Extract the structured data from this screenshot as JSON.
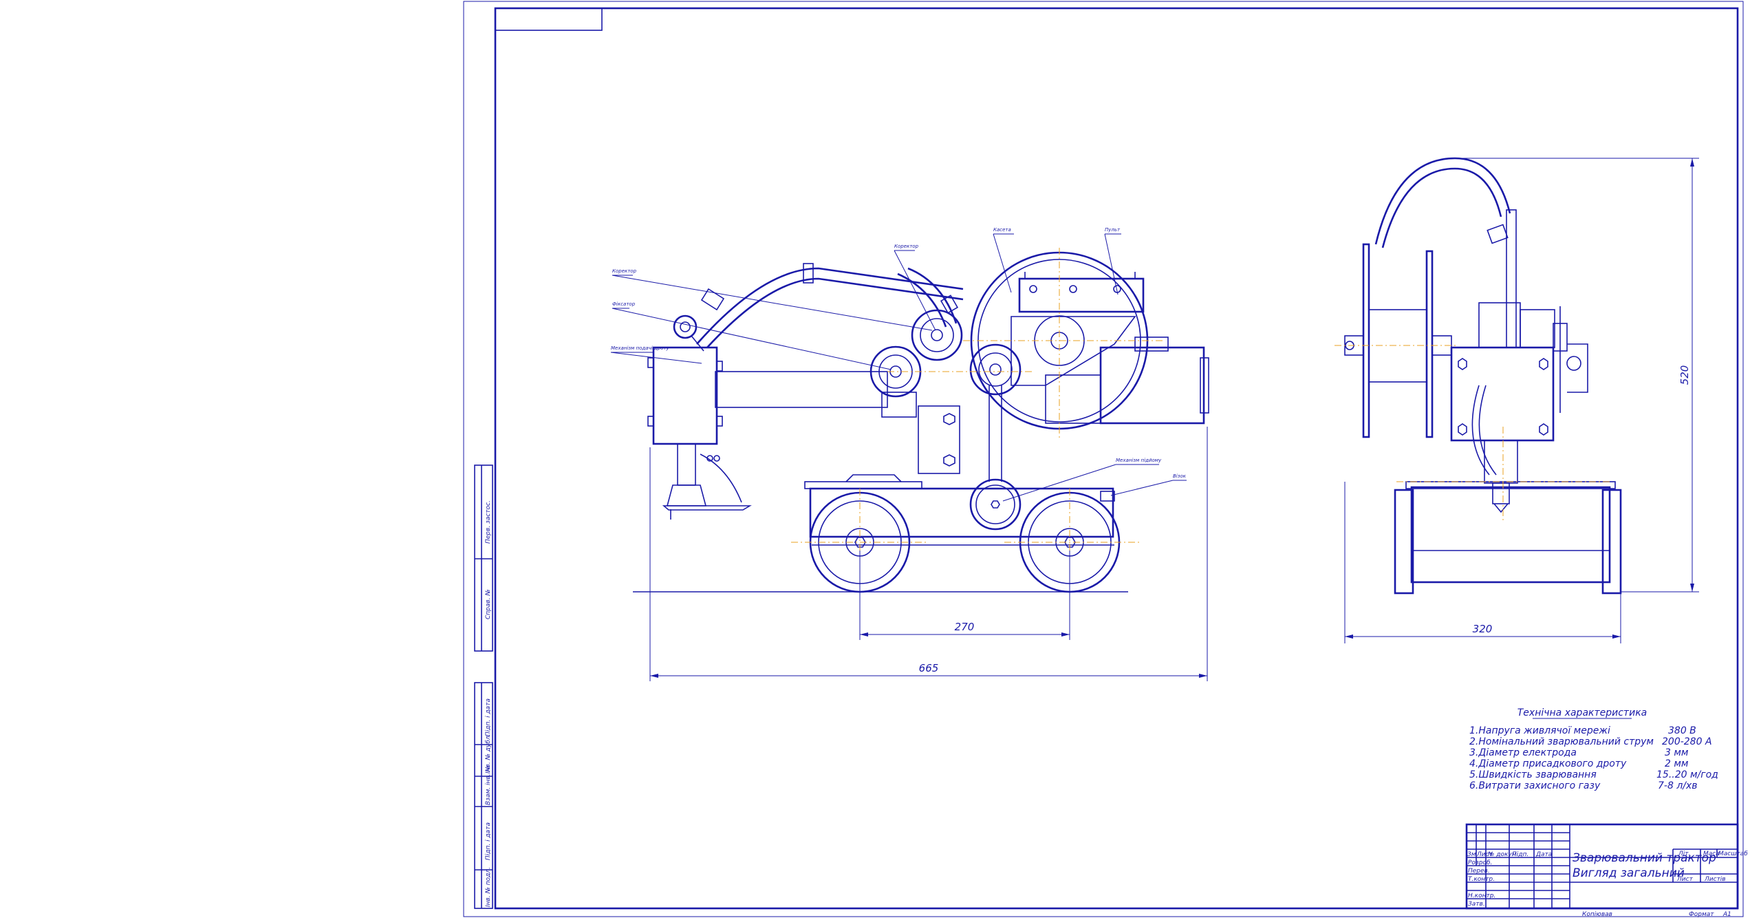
{
  "title_block": {
    "name_line1": "Зварювальний трактор",
    "name_line2": "Вигляд загальний",
    "headers": [
      "Зм",
      "Лист",
      "№ докум.",
      "Підп.",
      "Дата"
    ],
    "roles": [
      "Розроб.",
      "Перев.",
      "Т.контр.",
      "Н.контр.",
      "Затв."
    ],
    "lit": "Літ.",
    "mass": "Маса",
    "scale": "Масштаб",
    "sheet": "Лист",
    "sheets": "Листів",
    "copied": "Копіював",
    "format": "Формат",
    "format_value": "А1"
  },
  "side_stamp": {
    "cells": [
      "Перв. застос.",
      "Справ. №",
      "Підп. і дата",
      "Інв. № дубл.",
      "Взам. інв. №",
      "Підп. і дата",
      "Інв. № подл."
    ]
  },
  "dimensions": {
    "wheelbase": "270",
    "overall_length": "665",
    "width": "320",
    "height": "520"
  },
  "callouts": {
    "corrector": "Коректор",
    "fixer": "Фіксатор",
    "wire_feed": "Механізм подачі дроту",
    "rollers": "Коректор",
    "cassette": "Касета",
    "panel": "Пульт",
    "lift": "Механізм підйому",
    "carriage": "Візок"
  },
  "specs": {
    "heading": "Технічна характеристика",
    "items": [
      {
        "label": "1.Напруга живлячої мережі",
        "value": "380 В"
      },
      {
        "label": "2.Номінальний зварювальний струм",
        "value": "200-280 А"
      },
      {
        "label": "3.Діаметр електрода",
        "value": "3 мм"
      },
      {
        "label": "4.Діаметр присадкового дроту",
        "value": "2 мм"
      },
      {
        "label": "5.Швидкість зварювання",
        "value": "15..20 м/год"
      },
      {
        "label": "6.Витрати захисного газу",
        "value": "7-8 л/хв"
      }
    ]
  }
}
